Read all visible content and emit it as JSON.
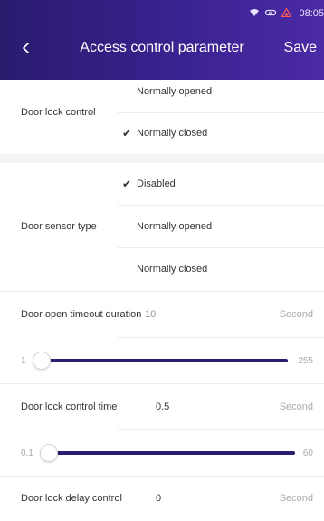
{
  "status_bar": {
    "wifi_icon": "wifi-icon",
    "link_icon": "link-icon",
    "alert_icon": "alert-icon",
    "time": "08:05"
  },
  "header": {
    "title": "Access control parameter",
    "save_label": "Save",
    "back_icon": "chevron-left-icon"
  },
  "door_lock_control": {
    "label": "Door lock control",
    "options": [
      {
        "label": "Normally opened",
        "selected": false
      },
      {
        "label": "Normally closed",
        "selected": true
      }
    ]
  },
  "door_sensor_type": {
    "label": "Door sensor type",
    "options": [
      {
        "label": "Disabled",
        "selected": true
      },
      {
        "label": "Normally opened",
        "selected": false
      },
      {
        "label": "Normally closed",
        "selected": false
      }
    ]
  },
  "door_open_timeout": {
    "label": "Door open timeout duration",
    "value": "10",
    "unit": "Second",
    "slider": {
      "min": "1",
      "max": "255",
      "fraction": 0.0
    }
  },
  "door_lock_control_time": {
    "label": "Door lock control time",
    "value": "0.5",
    "unit": "Second",
    "slider": {
      "min": "0.1",
      "max": "60",
      "fraction": 0.0
    }
  },
  "door_lock_delay": {
    "label": "Door lock delay control",
    "value": "0",
    "unit": "Second"
  },
  "colors": {
    "accent": "#2b1a6e",
    "header_start": "#2a1b6e",
    "header_end": "#4b2aa6"
  },
  "check_glyph": "✔"
}
